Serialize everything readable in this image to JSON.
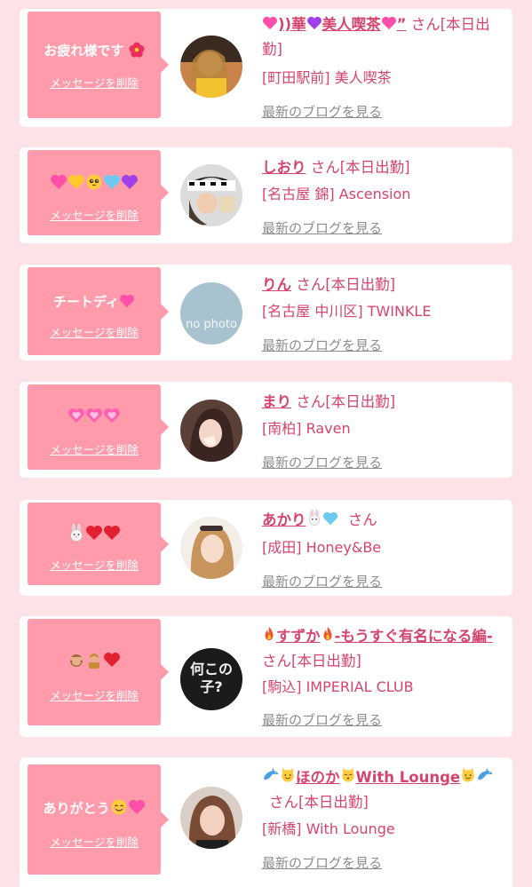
{
  "delete_label": "メッセージを削除",
  "blog_label": "最新のブログを見る",
  "colors": {
    "background": "#fde3e7",
    "bubble": "#ff9bab",
    "name": "#d5446f",
    "link_gray": "#8c8c8c"
  },
  "entries": [
    {
      "message": "お疲れ様です",
      "message_icons": [
        "hibiscus"
      ],
      "name_icons_before": [
        "pink-heart"
      ],
      "name": "))華",
      "name_icons_mid": [
        "purple-heart"
      ],
      "name_tail": "美人喫茶",
      "name_icons_after": [
        "pink-heart"
      ],
      "name_end": "”",
      "suffix": "さん[本日出勤]",
      "shop": "[町田駅前] 美人喫茶"
    },
    {
      "message": "",
      "message_icons": [
        "pink-heart",
        "yellow-heart",
        "pleading-face",
        "light-blue-heart",
        "purple-heart"
      ],
      "name": "しおり",
      "suffix": "さん[本日出勤]",
      "shop": "[名古屋 錦] Ascension"
    },
    {
      "message": "チートディ",
      "message_icons": [
        "pink-heart"
      ],
      "name": "りん",
      "suffix": "さん[本日出勤]",
      "shop": "[名古屋 中川区] TWINKLE",
      "avatar_text": "no photo"
    },
    {
      "message": "",
      "message_icons": [
        "pink-heart",
        "pink-heart",
        "pink-heart"
      ],
      "name": "まり",
      "suffix": "さん[本日出勤]",
      "shop": "[南柏] Raven"
    },
    {
      "message": "",
      "message_icons": [
        "rabbit-face",
        "red-heart",
        "red-heart"
      ],
      "name": "あかり",
      "name_icons_after": [
        "rabbit-face",
        "light-blue-heart"
      ],
      "suffix": "さん",
      "shop": "[成田] Honey&Be"
    },
    {
      "message": "",
      "message_icons": [
        "see-no-evil-monkey",
        "person-gesturing",
        "red-heart"
      ],
      "name_icons_before": [
        "fire"
      ],
      "name": "すずか",
      "name_icons_mid": [
        "fire"
      ],
      "name_tail": "-もうすぐ有名になる編-",
      "suffix": "さん[本日出勤]",
      "shop": "[駒込] IMPERIAL CLUB",
      "avatar_text": "何この子?"
    },
    {
      "message": "ありがとう",
      "message_icons": [
        "smiling-face",
        "pink-heart"
      ],
      "name_icons_before": [
        "dolphin",
        "cat-face"
      ],
      "name": "ほのか",
      "name_icons_mid": [
        "kissing-cat"
      ],
      "name_tail": "With Lounge",
      "name_icons_after": [
        "cat-face",
        "dolphin"
      ],
      "suffix": "さん[本日出勤]",
      "shop": "[新橋] With Lounge"
    }
  ]
}
